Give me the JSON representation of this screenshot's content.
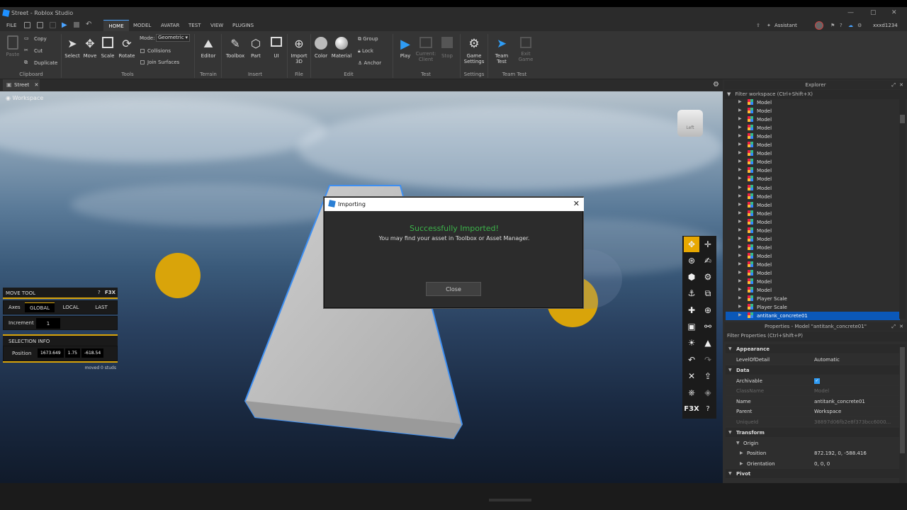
{
  "window": {
    "title": "Street - Roblox Studio",
    "controls": [
      "—",
      "▢",
      "✕"
    ]
  },
  "menu": {
    "file": "FILE",
    "tabs": [
      "HOME",
      "MODEL",
      "AVATAR",
      "TEST",
      "VIEW",
      "PLUGINS"
    ],
    "assistant": "Assistant",
    "user": "xxxd1234"
  },
  "ribbon": {
    "clipboard": {
      "paste": "Paste",
      "copy": "Copy",
      "cut": "Cut",
      "duplicate": "Duplicate",
      "group": "Clipboard"
    },
    "tools": {
      "select": "Select",
      "move": "Move",
      "scale": "Scale",
      "rotate": "Rotate",
      "mode_label": "Mode:",
      "mode_value": "Geometric",
      "collisions": "Collisions",
      "join_surfaces": "Join Surfaces",
      "group": "Tools"
    },
    "terrain": {
      "editor": "Editor",
      "group": "Terrain"
    },
    "insert": {
      "toolbox": "Toolbox",
      "part": "Part",
      "ui": "UI",
      "group": "Insert"
    },
    "file": {
      "import3d_1": "Import",
      "import3d_2": "3D",
      "group": "File"
    },
    "edit": {
      "color": "Color",
      "material": "Material",
      "group_btn": "Group",
      "lock": "Lock",
      "anchor": "Anchor",
      "group": "Edit"
    },
    "test": {
      "play": "Play",
      "current_client_1": "Current:",
      "current_client_2": "Client",
      "stop": "Stop",
      "group": "Test"
    },
    "settings": {
      "game_settings_1": "Game",
      "game_settings_2": "Settings",
      "group": "Settings"
    },
    "team_test": {
      "team_test_1": "Team",
      "team_test_2": "Test",
      "exit_game_1": "Exit",
      "exit_game_2": "Game",
      "group": "Team Test"
    }
  },
  "doc_tab": {
    "label": "Street"
  },
  "viewport": {
    "workspace_label": "Workspace",
    "view_cube_label": "Left"
  },
  "move_tool": {
    "title": "MOVE TOOL",
    "help": "?",
    "brand": "F3X",
    "axes_label": "Axes",
    "axes": [
      "GLOBAL",
      "LOCAL",
      "LAST"
    ],
    "increment_label": "Increment",
    "increment_value": "1",
    "selection_title": "SELECTION INFO",
    "position_label": "Position",
    "position": [
      "1673.649",
      "1.75",
      "-618.54"
    ],
    "moved": "moved 0 studs"
  },
  "tool_column": {
    "brand": "F3X"
  },
  "dialog": {
    "title": "Importing",
    "success": "Successfully Imported!",
    "message": "You may find your asset in Toolbox or Asset Manager.",
    "close_button": "Close"
  },
  "explorer": {
    "title": "Explorer",
    "filter_placeholder": "Filter workspace (Ctrl+Shift+X)",
    "items": [
      "Model",
      "Model",
      "Model",
      "Model",
      "Model",
      "Model",
      "Model",
      "Model",
      "Model",
      "Model",
      "Model",
      "Model",
      "Model",
      "Model",
      "Model",
      "Model",
      "Model",
      "Model",
      "Model",
      "Model",
      "Model",
      "Model",
      "Model",
      "Player Scale",
      "Player Scale",
      "antitank_concrete01"
    ]
  },
  "properties": {
    "title": "Properties - Model \"antitank_concrete01\"",
    "filter_placeholder": "Filter Properties (Ctrl+Shift+P)",
    "rows": [
      {
        "type": "cat",
        "k": "Appearance",
        "v": ""
      },
      {
        "type": "prop",
        "k": "LevelOfDetail",
        "v": "Automatic"
      },
      {
        "type": "cat",
        "k": "Data",
        "v": ""
      },
      {
        "type": "prop",
        "k": "Archivable",
        "v": ""
      },
      {
        "type": "dim",
        "k": "ClassName",
        "v": "Model"
      },
      {
        "type": "prop",
        "k": "Name",
        "v": "antitank_concrete01"
      },
      {
        "type": "prop",
        "k": "Parent",
        "v": "Workspace"
      },
      {
        "type": "dim",
        "k": "UniqueId",
        "v": "38897d06fb2e8f373bcc6000..."
      },
      {
        "type": "cat",
        "k": "Transform",
        "v": ""
      },
      {
        "type": "sub",
        "k": "Origin",
        "v": ""
      },
      {
        "type": "sub2",
        "k": "Position",
        "v": "872.192, 0, -588.416"
      },
      {
        "type": "sub2",
        "k": "Orientation",
        "v": "0, 0, 0"
      },
      {
        "type": "cat",
        "k": "Pivot",
        "v": ""
      }
    ]
  },
  "colors": {
    "accent_blue": "#0b58b8",
    "success_green": "#3cb34a",
    "f3x_gold": "#d9a40a"
  }
}
